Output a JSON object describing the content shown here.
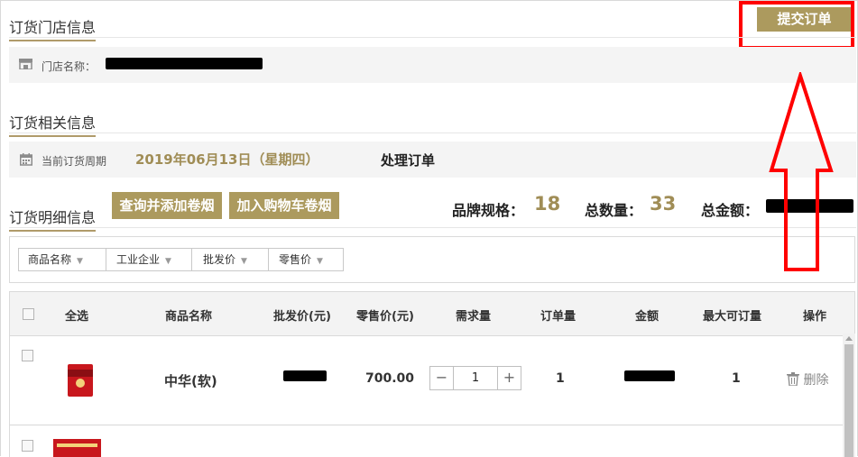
{
  "submit_button": "提交订单",
  "store_section": {
    "title": "订货门店信息",
    "store_label": "门店名称："
  },
  "order_section": {
    "title": "订货相关信息",
    "period_label": "当前订货周期",
    "period_value": "2019年06月13日（星期四）",
    "process_text": "处理订单"
  },
  "detail_section": {
    "title": "订货明细信息",
    "query_button": "查询并添加卷烟",
    "add_cart_button": "加入购物车卷烟",
    "brand_label": "品牌规格：",
    "brand_count": "18",
    "qty_label": "总数量：",
    "qty_value": "33",
    "amount_label": "总金额："
  },
  "sort_buttons": [
    {
      "label": "商品名称"
    },
    {
      "label": "工业企业"
    },
    {
      "label": "批发价"
    },
    {
      "label": "零售价"
    }
  ],
  "table": {
    "headers": {
      "select_all": "全选",
      "name": "商品名称",
      "wholesale": "批发价(元)",
      "retail": "零售价(元)",
      "demand": "需求量",
      "order_qty": "订单量",
      "amount": "金额",
      "max_qty": "最大可订量",
      "action": "操作"
    },
    "rows": [
      {
        "name": "中华(软)",
        "retail": "700.00",
        "demand": "1",
        "order_qty": "1",
        "max_qty": "1",
        "action": "删除"
      }
    ]
  },
  "stepper": {
    "minus": "−",
    "plus": "+"
  },
  "colors": {
    "gold": "#ac9a5e",
    "gold_text": "#a08d56",
    "highlight_red": "#ff0000"
  },
  "icons": [
    "store-icon",
    "calendar-icon",
    "sort-arrow-icon",
    "trash-icon",
    "up-arrow-annotation"
  ]
}
